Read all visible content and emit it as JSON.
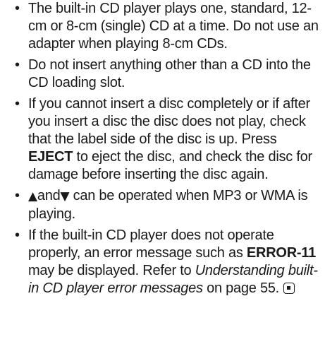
{
  "bullets": [
    {
      "text": "The built-in CD player plays one, standard, 12-cm or 8-cm (single) CD at a time. Do not use an adapter when playing 8-cm CDs."
    },
    {
      "text": "Do not insert anything other than a CD into the CD loading slot."
    },
    {
      "text_before": "If you cannot insert a disc completely or if after you insert a disc the disc does not play, check that the label side of the disc is up. Press ",
      "bold": "EJECT",
      "text_after": " to eject the disc, and check the disc for damage before inserting the disc again."
    },
    {
      "up_arrow": "▲",
      "and_word": "and",
      "down_arrow": "▼",
      "text_after": " can be operated when MP3 or WMA is playing."
    },
    {
      "text_before": "If the built-in CD player does not operate properly, an error message such as ",
      "bold": "ERROR-11",
      "text_middle": " may be displayed. Refer to ",
      "italic": "Understanding built-in CD player error messages",
      "text_after": " on page 55."
    }
  ],
  "bullet_symbol": "•",
  "end_mark_icon": "end-of-section-icon"
}
